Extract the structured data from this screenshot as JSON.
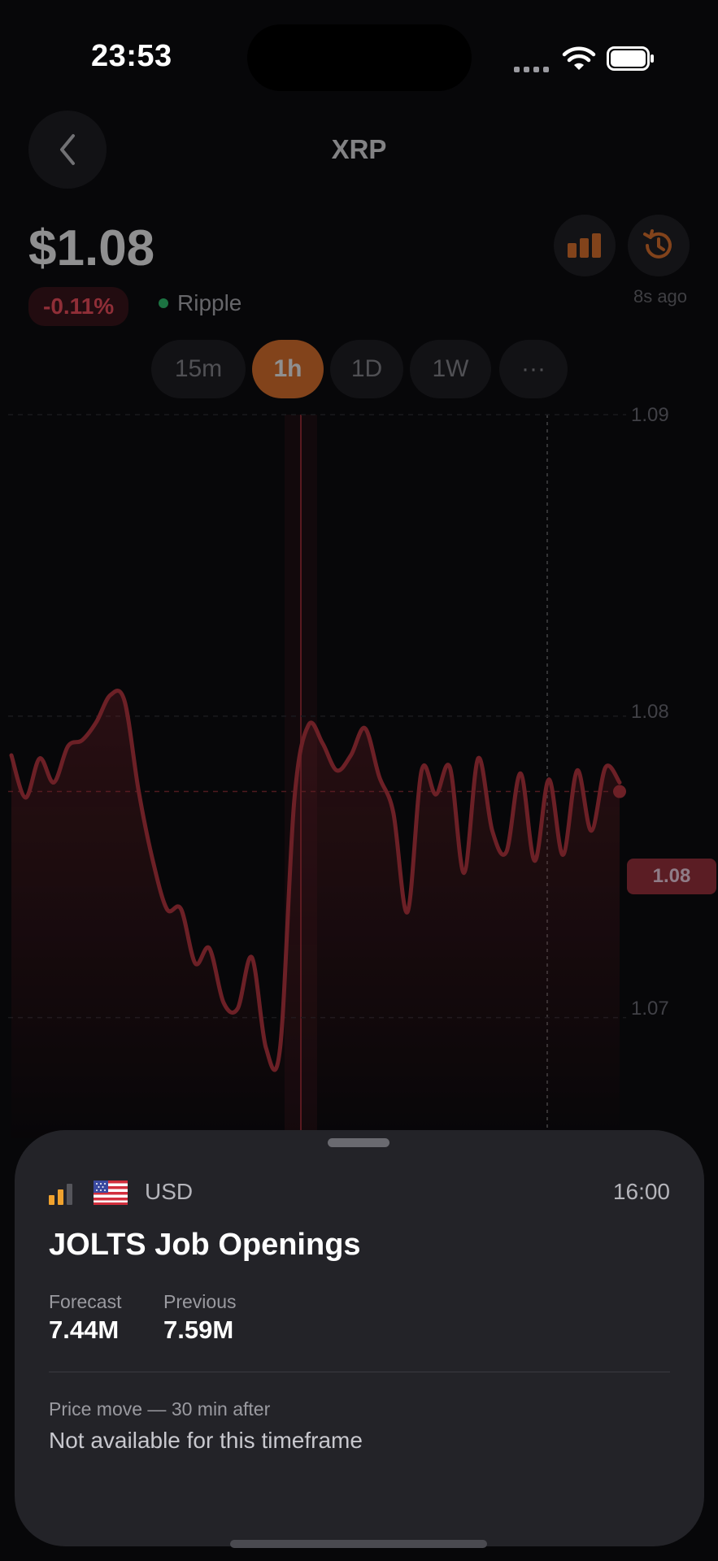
{
  "status_bar": {
    "time": "23:53"
  },
  "header": {
    "title": "XRP"
  },
  "quote": {
    "price": "$1.08",
    "change": "-0.11%",
    "network": "Ripple",
    "updated": "8s ago"
  },
  "timeframes": [
    {
      "label": "15m",
      "active": false
    },
    {
      "label": "1h",
      "active": true
    },
    {
      "label": "1D",
      "active": false
    },
    {
      "label": "1W",
      "active": false
    },
    {
      "label": "···",
      "active": false
    }
  ],
  "chart_data": {
    "type": "line",
    "y_ticks": [
      "1.09",
      "1.08",
      "1.07"
    ],
    "ylim": [
      1.066,
      1.09
    ],
    "current_value_label": "1.08",
    "current_value": 1.0775,
    "series": [
      {
        "color": "#c0353f",
        "values": [
          1.0787,
          1.0773,
          1.0786,
          1.0778,
          1.079,
          1.0792,
          1.0798,
          1.0807,
          1.0805,
          1.0775,
          1.0752,
          1.0736,
          1.0736,
          1.0718,
          1.0723,
          1.0705,
          1.0703,
          1.072,
          1.069,
          1.069,
          1.0772,
          1.0797,
          1.0791,
          1.0782,
          1.0787,
          1.0796,
          1.078,
          1.0768,
          1.0735,
          1.0782,
          1.0774,
          1.0783,
          1.0748,
          1.0786,
          1.0762,
          1.0755,
          1.0781,
          1.0752,
          1.0779,
          1.0754,
          1.0782,
          1.0762,
          1.0783,
          1.0778
        ]
      }
    ],
    "colors": {
      "line": "#c0353f",
      "accent": "#e8762a"
    }
  },
  "event_sheet": {
    "currency": "USD",
    "time": "16:00",
    "title": "JOLTS Job Openings",
    "forecast_label": "Forecast",
    "forecast": "7.44M",
    "previous_label": "Previous",
    "previous": "7.59M",
    "move_label": "Price move — 30 min after",
    "move_value": "Not available for this timeframe"
  }
}
